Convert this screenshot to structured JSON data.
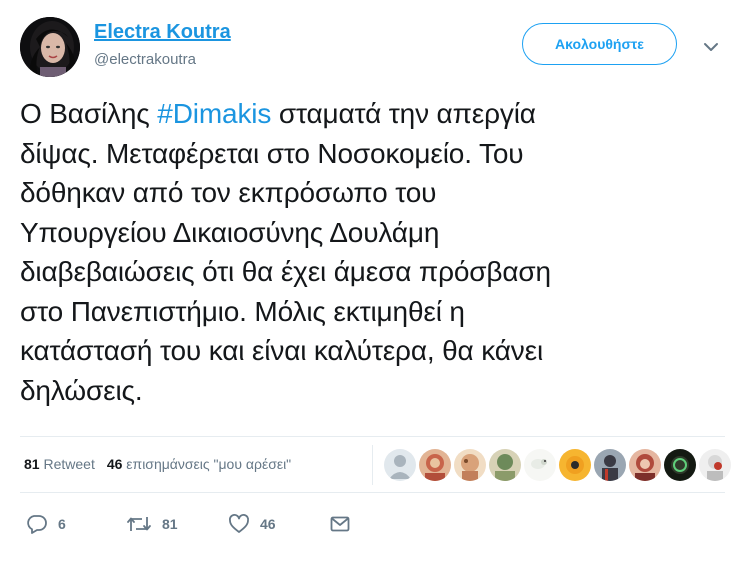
{
  "user": {
    "name": "Electra Koutra",
    "handle": "@electrakoutra",
    "avatar_icon": "profile-photo"
  },
  "follow_button": {
    "label": "Ακολουθήστε"
  },
  "menu_icon": "chevron-down-icon",
  "tweet": {
    "lines": [
      {
        "before": "Ο Βασίλης ",
        "hashtag": "#Dimakis",
        "after": " σταματά την απεργία"
      },
      {
        "text": "δίψας. Μεταφέρεται στο Νοσοκομείο. Του"
      },
      {
        "text": "δόθηκαν από τον εκπρόσωπο του"
      },
      {
        "text": "Υπουργείου Δικαιοσύνης Δουλάμη"
      },
      {
        "text": "διαβεβαιώσεις ότι θα έχει άμεσα πρόσβαση"
      },
      {
        "text": "στο Πανεπιστήμιο. Μόλις εκτιμηθεί η"
      },
      {
        "text": "κατάστασή του και είναι καλύτερα, θα κάνει"
      },
      {
        "text": "δηλώσεις."
      }
    ]
  },
  "stats": {
    "retweets_count": "81",
    "retweets_label": "Retweet",
    "likes_count": "46",
    "likes_label": "επισημάνσεις \"μου αρέσει\""
  },
  "likers": [
    {
      "icon": "default-avatar",
      "color": "#a9b4bd"
    },
    {
      "icon": "liker-avatar",
      "color": "#c8644a"
    },
    {
      "icon": "liker-avatar",
      "color": "#d9a27a"
    },
    {
      "icon": "liker-avatar",
      "color": "#6d8a5a"
    },
    {
      "icon": "liker-avatar",
      "color": "#e8ece6"
    },
    {
      "icon": "liker-avatar",
      "color": "#f0a020"
    },
    {
      "icon": "liker-avatar",
      "color": "#3a3a44"
    },
    {
      "icon": "liker-avatar",
      "color": "#b04a3c"
    },
    {
      "icon": "liker-avatar",
      "color": "#2f3a2a"
    },
    {
      "icon": "liker-avatar",
      "color": "#d8d8d8"
    }
  ],
  "actions": {
    "reply_count": "6",
    "retweet_count": "81",
    "like_count": "46",
    "reply_icon": "reply-icon",
    "retweet_icon": "retweet-icon",
    "like_icon": "heart-icon",
    "dm_icon": "envelope-icon"
  },
  "colors": {
    "link": "#1b95e0",
    "accent": "#1da1f2",
    "muted": "#657786",
    "text": "#14171a"
  }
}
